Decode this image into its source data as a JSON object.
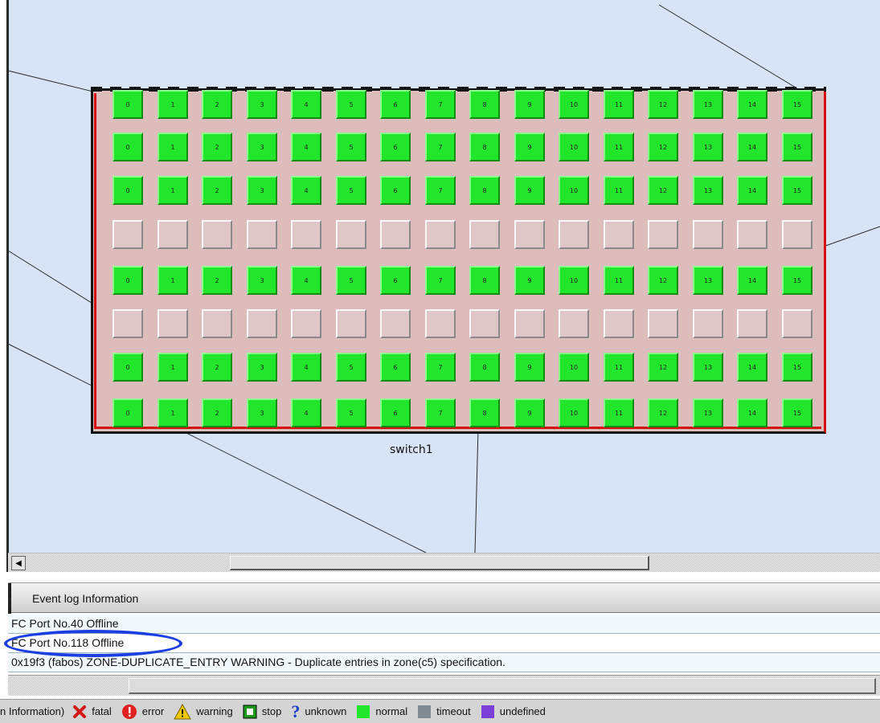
{
  "switch": {
    "label": "switch1",
    "port_labels": [
      "0",
      "1",
      "2",
      "3",
      "4",
      "5",
      "6",
      "7",
      "8",
      "9",
      "10",
      "11",
      "12",
      "13",
      "14",
      "15"
    ],
    "row_status": [
      "active",
      "active",
      "active",
      "empty",
      "active",
      "empty",
      "active",
      "active"
    ]
  },
  "event_log": {
    "title": "Event log Information",
    "entries": [
      "FC Port No.40 Offline",
      "FC Port No.118 Offline",
      "0x19f3 (fabos) ZONE-DUPLICATE_ENTRY WARNING - Duplicate entries in zone(c5) specification."
    ],
    "highlighted_entry_index": 1
  },
  "legend": {
    "prefix": "n Information)",
    "items": [
      {
        "label": "fatal",
        "icon": "fatal-x-icon",
        "color": "#d01818"
      },
      {
        "label": "error",
        "icon": "error-circle-icon",
        "color": "#e02020"
      },
      {
        "label": "warning",
        "icon": "warning-triangle-icon",
        "color": "#f0c800"
      },
      {
        "label": "stop",
        "icon": "stop-square-icon",
        "color": "#1a9a1a"
      },
      {
        "label": "unknown",
        "icon": "question-mark-icon",
        "color": "#1840c8"
      },
      {
        "label": "normal",
        "icon": "normal-square-icon",
        "color": "#22e62c"
      },
      {
        "label": "timeout",
        "icon": "timeout-square-icon",
        "color": "#7f8a92"
      },
      {
        "label": "undefined",
        "icon": "undefined-square-icon",
        "color": "#7a40d8"
      }
    ]
  },
  "colors": {
    "port_active": "#22e62c",
    "port_empty": "#e0c7c7",
    "canvas_background": "#d6e4f6",
    "switch_background": "#ddbcbc",
    "highlight_outline": "#1b3fe0"
  }
}
